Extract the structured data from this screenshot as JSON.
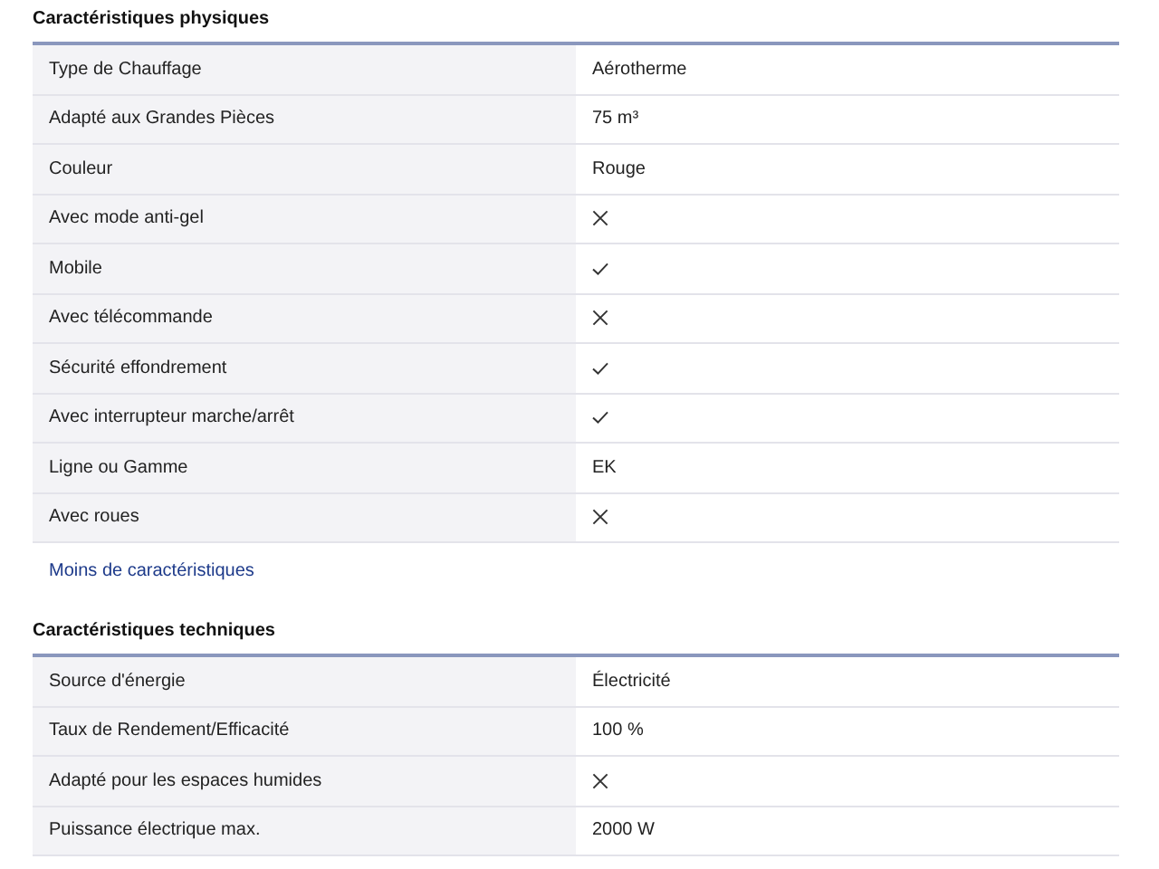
{
  "sections": [
    {
      "title": "Caractéristiques physiques",
      "rows": [
        {
          "label": "Type de Chauffage",
          "kind": "text",
          "value": "Aérotherme"
        },
        {
          "label": "Adapté aux Grandes Pièces",
          "kind": "text",
          "value": "75 m³"
        },
        {
          "label": "Couleur",
          "kind": "text",
          "value": "Rouge"
        },
        {
          "label": "Avec mode anti-gel",
          "kind": "flag",
          "checked": false
        },
        {
          "label": "Mobile",
          "kind": "flag",
          "checked": true
        },
        {
          "label": "Avec télécommande",
          "kind": "flag",
          "checked": false
        },
        {
          "label": "Sécurité effondrement",
          "kind": "flag",
          "checked": true
        },
        {
          "label": "Avec interrupteur marche/arrêt",
          "kind": "flag",
          "checked": true
        },
        {
          "label": "Ligne ou Gamme",
          "kind": "text",
          "value": "EK"
        },
        {
          "label": "Avec roues",
          "kind": "flag",
          "checked": false
        }
      ],
      "link": "Moins de caractéristiques"
    },
    {
      "title": "Caractéristiques techniques",
      "rows": [
        {
          "label": "Source d'énergie",
          "kind": "text",
          "value": "Électricité"
        },
        {
          "label": "Taux de Rendement/Efficacité",
          "kind": "text",
          "value": "100 %"
        },
        {
          "label": "Adapté pour les espaces humides",
          "kind": "flag",
          "checked": false
        },
        {
          "label": "Puissance électrique max.",
          "kind": "text",
          "value": "2000 W"
        }
      ]
    }
  ]
}
